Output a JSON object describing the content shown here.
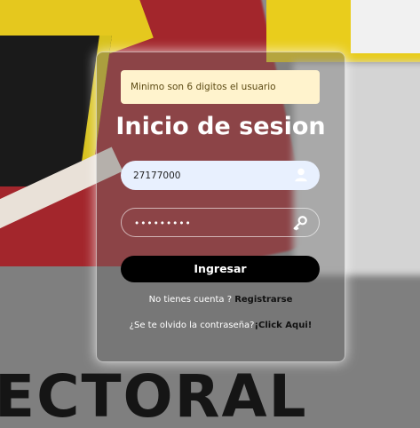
{
  "background": {
    "word": "ECTORAL"
  },
  "alert": {
    "text": "Minimo son 6 digitos el usuario"
  },
  "form": {
    "title": "Inicio de sesion",
    "username_value": "27177000",
    "password_value": "•••••••••",
    "submit_label": "Ingresar",
    "register_prompt": "No tienes cuenta ?",
    "register_link": "Registrarse",
    "forgot_prompt": "¿Se te olvido la contraseña?",
    "forgot_link": "¡Click Aqui!"
  },
  "icons": {
    "user": "user-icon",
    "password": "key-icon"
  }
}
